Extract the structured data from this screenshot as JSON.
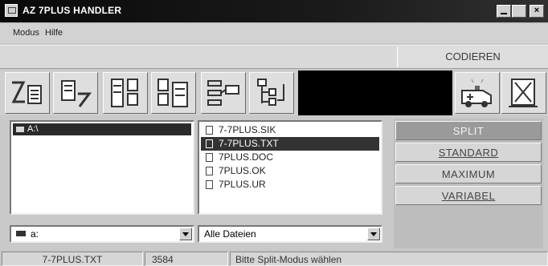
{
  "window": {
    "title": "AZ 7PLUS HANDLER"
  },
  "menu": {
    "modus": "Modus",
    "hilfe": "Hilfe"
  },
  "toolbar": {
    "mode_label": "CODIEREN",
    "icons": [
      "encode-icon",
      "decode-icon",
      "split-files-icon",
      "join-files-icon",
      "network-icon",
      "tree-icon",
      "ambulance-icon",
      "exit-icon"
    ]
  },
  "directories": {
    "items": [
      "A:\\"
    ],
    "selected": "A:\\"
  },
  "files": {
    "items": [
      "7-7PLUS.SIK",
      "7-7PLUS.TXT",
      "7PLUS.DOC",
      "7PLUS.OK",
      "7PLUS.UR"
    ],
    "selected_index": 1
  },
  "drive_combo": {
    "value": "a:"
  },
  "filter_combo": {
    "value": "Alle Dateien"
  },
  "modes": {
    "split": "SPLIT",
    "standard": "STANDARD",
    "maximum": "MAXIMUM",
    "variabel": "VARIABEL",
    "active": "split"
  },
  "status": {
    "file": "7-7PLUS.TXT",
    "size": "3584",
    "message": "Bitte Split-Modus wählen"
  },
  "colors": {
    "titlebar": "#0a0a0a",
    "selection": "#333333",
    "active_mode": "#9a9a9a"
  }
}
